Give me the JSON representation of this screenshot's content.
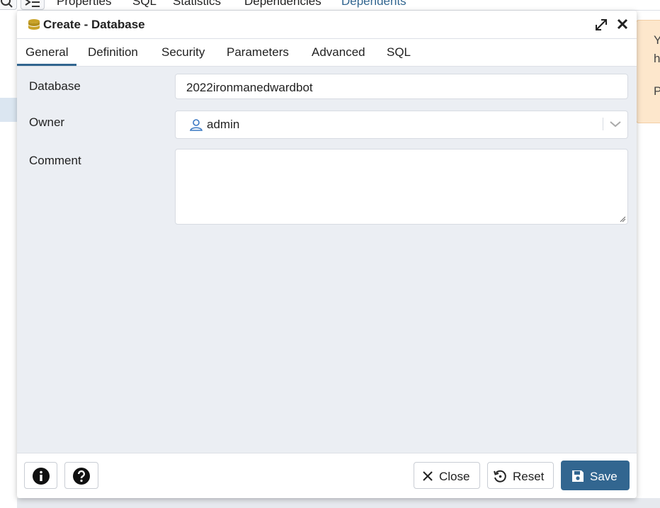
{
  "background": {
    "tabs": [
      {
        "label": "Properties"
      },
      {
        "label": "SQL"
      },
      {
        "label": "Statistics"
      },
      {
        "label": "Dependencies"
      },
      {
        "label": "Dependents"
      }
    ],
    "notice": {
      "line1": "Y",
      "line2": "h",
      "line3": "P"
    }
  },
  "dialog": {
    "title": "Create - Database",
    "tabs": [
      {
        "label": "General"
      },
      {
        "label": "Definition"
      },
      {
        "label": "Security"
      },
      {
        "label": "Parameters"
      },
      {
        "label": "Advanced"
      },
      {
        "label": "SQL"
      }
    ],
    "active_tab": "General",
    "fields": {
      "database": {
        "label": "Database",
        "value": "2022ironmanedwardbot"
      },
      "owner": {
        "label": "Owner",
        "value": "admin"
      },
      "comment": {
        "label": "Comment",
        "value": ""
      }
    },
    "footer": {
      "close_label": "Close",
      "reset_label": "Reset",
      "save_label": "Save"
    }
  },
  "colors": {
    "accent": "#326690",
    "dialog_body": "#ebeef3",
    "notice_bg": "#fde7cc",
    "db_icon": "#c9a227"
  }
}
